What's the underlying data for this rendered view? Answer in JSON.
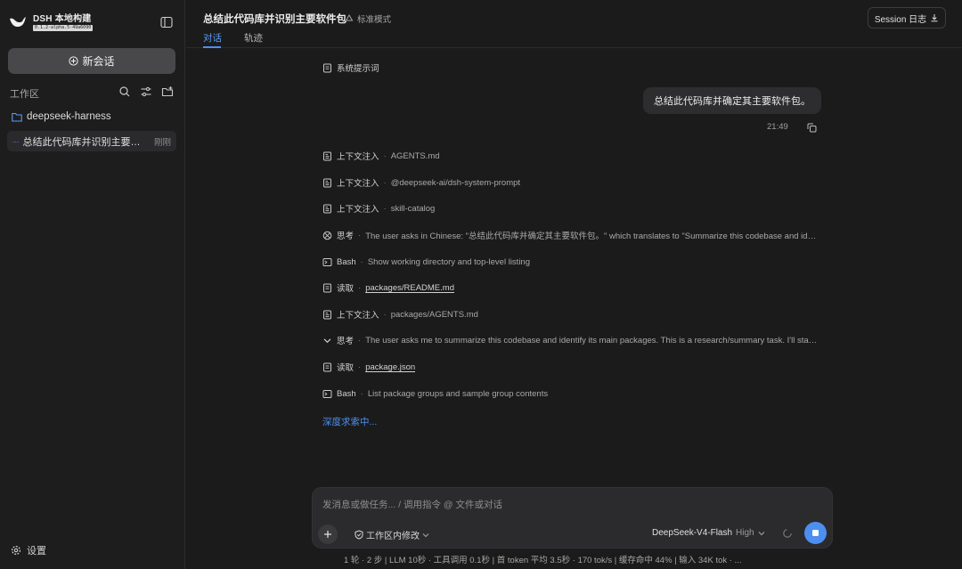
{
  "sidebar": {
    "brand_name": "DSH 本地构建",
    "brand_version": "0.1.2-alpha.5-49a6090",
    "new_chat_label": "新会话",
    "workspace_label": "工作区",
    "folder_name": "deepseek-harness",
    "session": {
      "indicator": "...",
      "title": "总结此代码库并识别主要软件包",
      "time": "刚刚"
    },
    "settings_label": "设置"
  },
  "header": {
    "title": "总结此代码库并识别主要软件包",
    "mode": "标准模式",
    "tabs": [
      "对话",
      "轨迹"
    ],
    "session_log_label": "Session 日志"
  },
  "conversation": {
    "system_prompt_label": "系统提示词",
    "user_message": "总结此代码库并确定其主要软件包。",
    "user_message_time": "21:49",
    "separator": "·",
    "events": [
      {
        "icon": "context-icon",
        "kind": "上下文注入",
        "detail": "AGENTS.md"
      },
      {
        "icon": "context-icon",
        "kind": "上下文注入",
        "detail": "@deepseek-ai/dsh-system-prompt"
      },
      {
        "icon": "context-icon",
        "kind": "上下文注入",
        "detail": "skill-catalog"
      },
      {
        "icon": "brain-icon",
        "kind": "思考",
        "detail": "The user asks in Chinese: \"总结此代码库并确定其主要软件包。\" which translates to \"Summarize this codebase and identify its main packages.\""
      },
      {
        "icon": "terminal-icon",
        "kind": "Bash",
        "detail": "Show working directory and top-level listing"
      },
      {
        "icon": "file-icon",
        "kind": "读取",
        "detail": "packages/README.md"
      },
      {
        "icon": "context-icon",
        "kind": "上下文注入",
        "detail": "packages/AGENTS.md"
      },
      {
        "icon": "chevron-down-icon",
        "kind": "思考",
        "detail": "The user asks me to summarize this codebase and identify its main packages. This is a research/summary task. I'll start by exploring."
      },
      {
        "icon": "file-icon",
        "kind": "读取",
        "detail": "package.json"
      },
      {
        "icon": "terminal-icon",
        "kind": "Bash",
        "detail": "List package groups and sample group contents"
      }
    ],
    "thinking_status": "深度求索中..."
  },
  "composer": {
    "placeholder": "发消息或做任务... / 调用指令 @ 文件或对话",
    "workspace_edit_label": "工作区内修改",
    "model_name": "DeepSeek-V4-Flash",
    "model_effort": "High"
  },
  "statusbar": {
    "text": "1 轮 · 2 步  |  LLM 10秒 · 工具调用 0.1秒  |  首 token 平均 3.5秒 · 170 tok/s  |  缓存命中 44%  |  输入 34K tok · ..."
  },
  "colors": {
    "accent": "#4d8ff0",
    "background": "#1b1b1c",
    "sidebar": "#1d1d1e",
    "bubble": "#2d2d2f"
  }
}
